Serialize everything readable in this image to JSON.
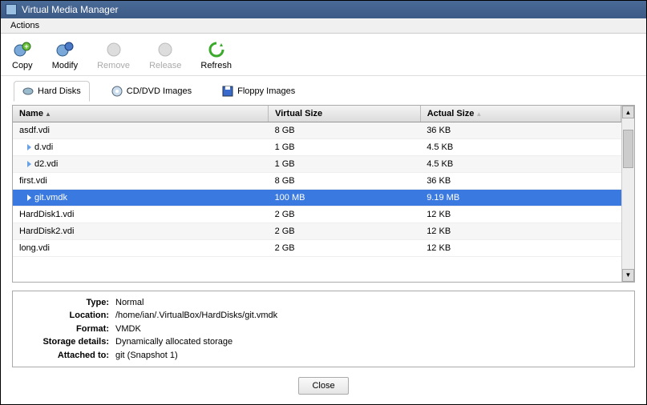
{
  "window": {
    "title": "Virtual Media Manager"
  },
  "menubar": {
    "actions": "Actions"
  },
  "toolbar": {
    "copy": "Copy",
    "modify": "Modify",
    "remove": "Remove",
    "release": "Release",
    "refresh": "Refresh"
  },
  "tabs": {
    "hdd": "Hard Disks",
    "cd": "CD/DVD Images",
    "floppy": "Floppy Images"
  },
  "table": {
    "headers": {
      "name": "Name",
      "vsize": "Virtual Size",
      "asize": "Actual Size"
    },
    "rows": [
      {
        "name": "asdf.vdi",
        "vsize": "8 GB",
        "asize": "36 KB",
        "expand": false
      },
      {
        "name": "d.vdi",
        "vsize": "1 GB",
        "asize": "4.5 KB",
        "expand": true
      },
      {
        "name": "d2.vdi",
        "vsize": "1 GB",
        "asize": "4.5 KB",
        "expand": true
      },
      {
        "name": "first.vdi",
        "vsize": "8 GB",
        "asize": "36 KB",
        "expand": false
      },
      {
        "name": "git.vmdk",
        "vsize": "100 MB",
        "asize": "9.19 MB",
        "expand": true,
        "selected": true
      },
      {
        "name": "HardDisk1.vdi",
        "vsize": "2 GB",
        "asize": "12 KB",
        "expand": false
      },
      {
        "name": "HardDisk2.vdi",
        "vsize": "2 GB",
        "asize": "12 KB",
        "expand": false
      },
      {
        "name": "long.vdi",
        "vsize": "2 GB",
        "asize": "12 KB",
        "expand": false
      }
    ]
  },
  "details": {
    "labels": {
      "type": "Type:",
      "location": "Location:",
      "format": "Format:",
      "storage": "Storage details:",
      "attached": "Attached to:"
    },
    "values": {
      "type": "Normal",
      "location": "/home/ian/.VirtualBox/HardDisks/git.vmdk",
      "format": "VMDK",
      "storage": "Dynamically allocated storage",
      "attached": "git (Snapshot 1)"
    }
  },
  "footer": {
    "close": "Close"
  },
  "colors": {
    "selection": "#3a79e0",
    "titlebar": "#3b5a85"
  }
}
